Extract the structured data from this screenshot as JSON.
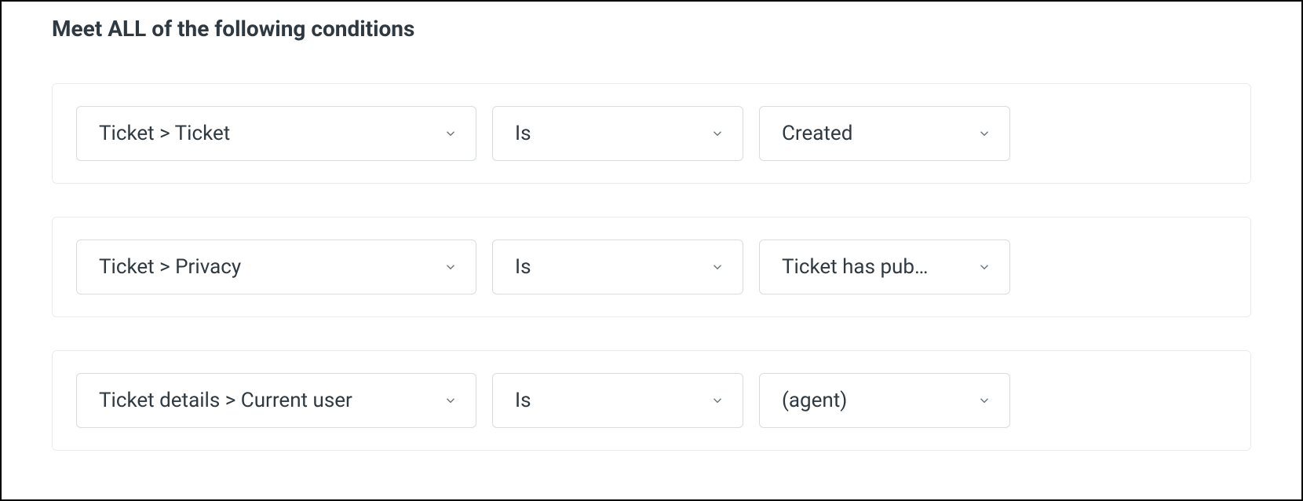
{
  "section": {
    "title": "Meet ALL of the following conditions"
  },
  "conditions": [
    {
      "subject": "Ticket > Ticket",
      "operator": "Is",
      "value": "Created"
    },
    {
      "subject": "Ticket > Privacy",
      "operator": "Is",
      "value": "Ticket has pub…"
    },
    {
      "subject": "Ticket details > Current user",
      "operator": "Is",
      "value": "(agent)"
    }
  ]
}
